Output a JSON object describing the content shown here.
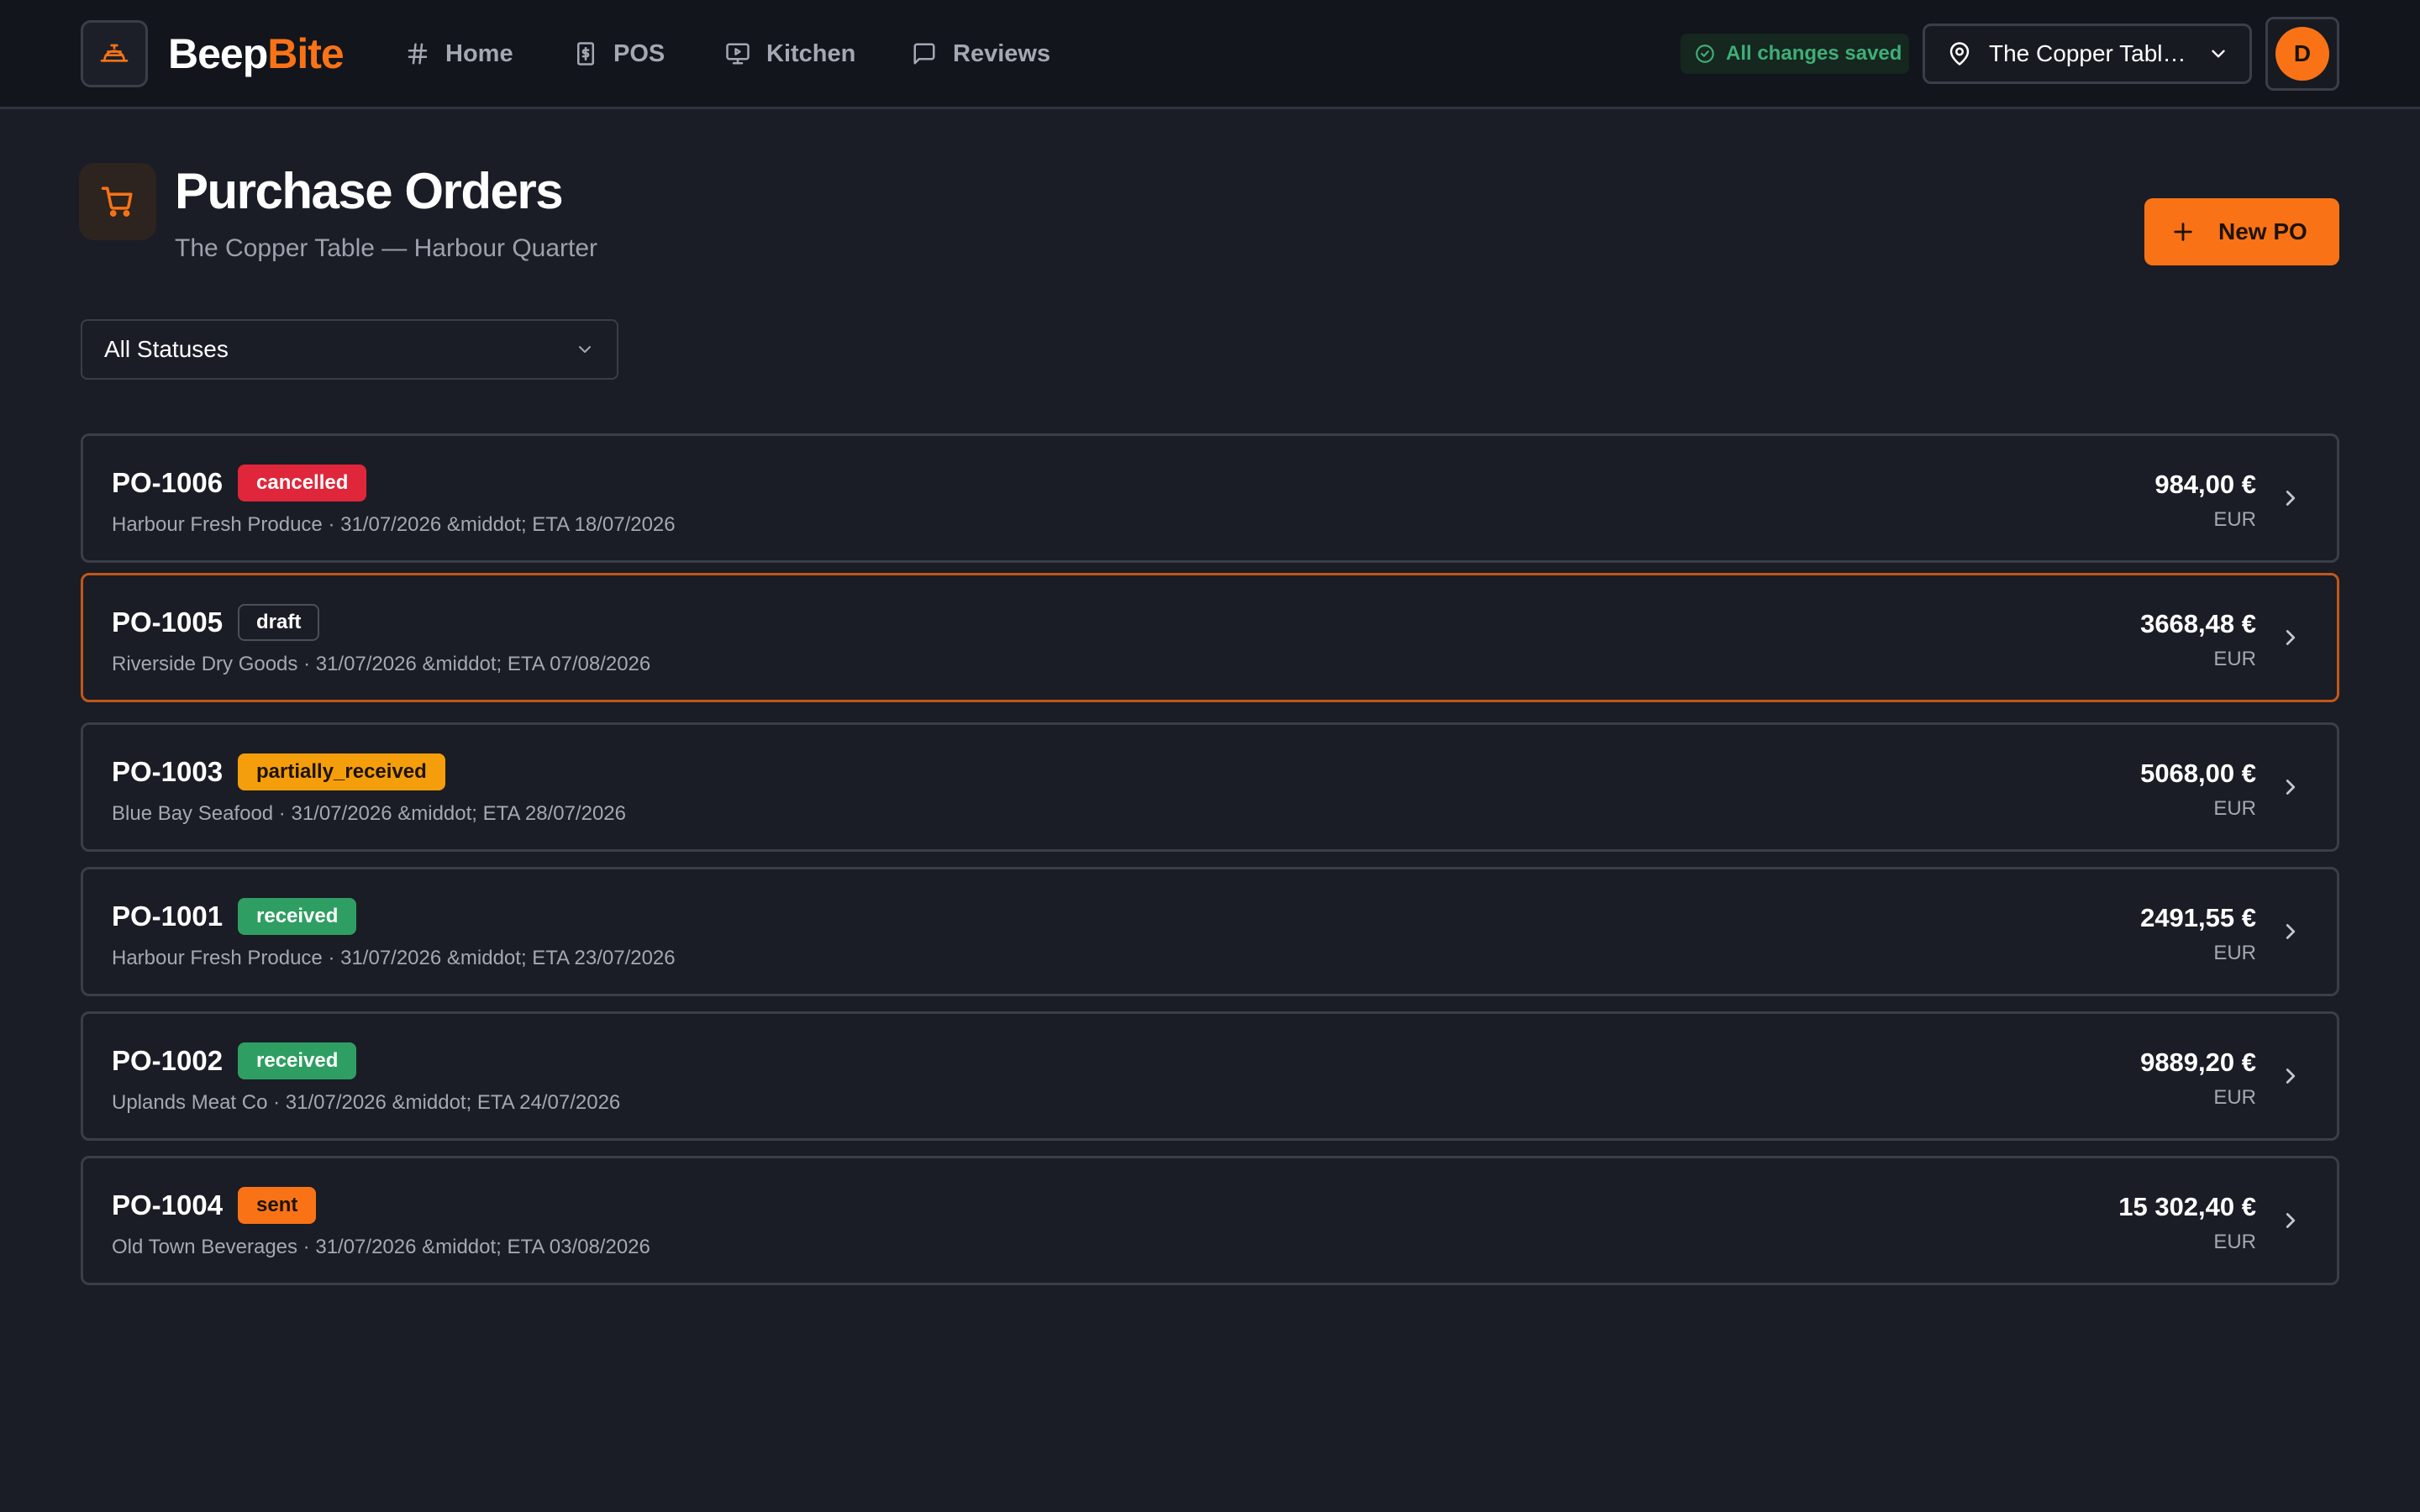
{
  "brand": {
    "name_part1": "Beep",
    "name_part2": "Bite",
    "accent_color": "#f97316"
  },
  "nav": {
    "items": [
      {
        "label": "Home",
        "icon": "hash-icon"
      },
      {
        "label": "POS",
        "icon": "receipt-dollar-icon"
      },
      {
        "label": "Kitchen",
        "icon": "monitor-play-icon"
      },
      {
        "label": "Reviews",
        "icon": "message-square-icon"
      }
    ]
  },
  "status": {
    "saved_label": "All changes saved",
    "color": "#3fae78"
  },
  "location": {
    "selected": "The Copper Tabl…"
  },
  "user": {
    "avatar_initial": "D"
  },
  "page": {
    "title": "Purchase Orders",
    "subtitle": "The Copper Table — Harbour Quarter",
    "new_button_label": "New PO"
  },
  "filter": {
    "selected": "All Statuses"
  },
  "purchase_orders": [
    {
      "number": "PO-1006",
      "status": "cancelled",
      "meta": "Harbour Fresh Produce · 31/07/2026 &middot; ETA 18/07/2026",
      "amount": "984,00 €",
      "currency": "EUR",
      "selected": false
    },
    {
      "number": "PO-1005",
      "status": "draft",
      "meta": "Riverside Dry Goods · 31/07/2026 &middot; ETA 07/08/2026",
      "amount": "3668,48 €",
      "currency": "EUR",
      "selected": true
    },
    {
      "number": "PO-1003",
      "status": "partially_received",
      "meta": "Blue Bay Seafood · 31/07/2026 &middot; ETA 28/07/2026",
      "amount": "5068,00 €",
      "currency": "EUR",
      "selected": false
    },
    {
      "number": "PO-1001",
      "status": "received",
      "meta": "Harbour Fresh Produce · 31/07/2026 &middot; ETA 23/07/2026",
      "amount": "2491,55 €",
      "currency": "EUR",
      "selected": false
    },
    {
      "number": "PO-1002",
      "status": "received",
      "meta": "Uplands Meat Co · 31/07/2026 &middot; ETA 24/07/2026",
      "amount": "9889,20 €",
      "currency": "EUR",
      "selected": false
    },
    {
      "number": "PO-1004",
      "status": "sent",
      "meta": "Old Town Beverages · 31/07/2026 &middot; ETA 03/08/2026",
      "amount": "15 302,40 €",
      "currency": "EUR",
      "selected": false
    }
  ]
}
